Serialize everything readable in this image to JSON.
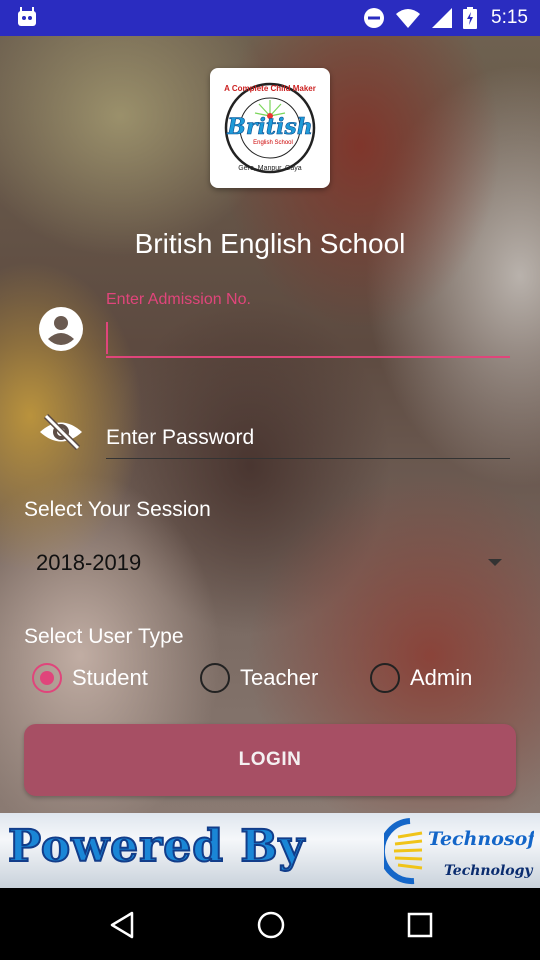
{
  "status_bar": {
    "time": "5:15"
  },
  "app": {
    "school_name": "British English School"
  },
  "logo": {
    "text_top": "A Complete Child Maker",
    "text_main": "British",
    "text_sub": "English School",
    "text_bottom": "Gere, Manpur, Gaya"
  },
  "form": {
    "admission_label": "Enter Admission No.",
    "admission_value": "",
    "password_placeholder": "Enter Password",
    "session_label": "Select Your Session",
    "session_value": "2018-2019",
    "user_type_label": "Select User Type",
    "user_types": [
      {
        "label": "Student",
        "checked": true
      },
      {
        "label": "Teacher",
        "checked": false
      },
      {
        "label": "Admin",
        "checked": false
      }
    ],
    "login_label": "LOGIN"
  },
  "footer": {
    "powered_text": "Powered By",
    "brand_line1": "Technosoft",
    "brand_line2": "Technology"
  },
  "colors": {
    "accent": "#e0457b",
    "status_bar": "#2a2cc0",
    "login_button": "#a74f64"
  }
}
